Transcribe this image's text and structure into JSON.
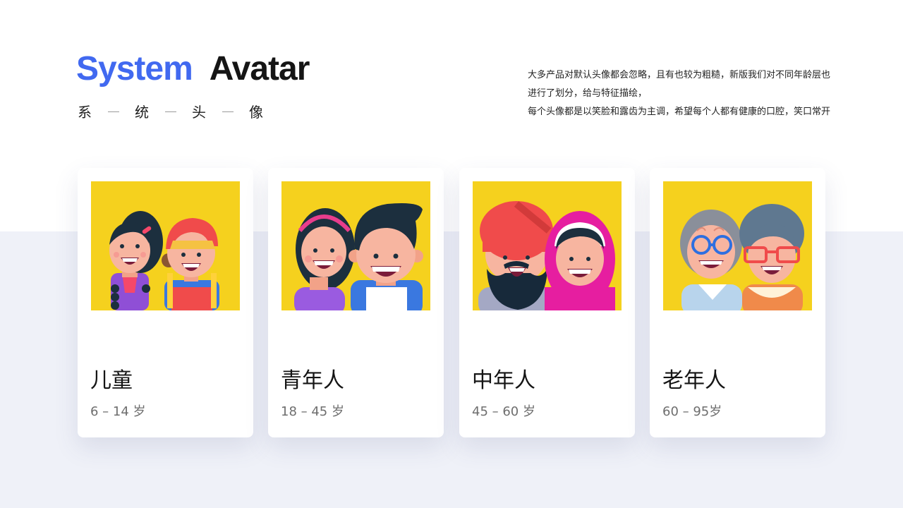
{
  "header": {
    "title_word1": "System",
    "title_word2": "Avatar",
    "subtitle_chars": [
      "系",
      "统",
      "头",
      "像"
    ]
  },
  "description": {
    "line1": "大多产品对默认头像都会忽略，且有也较为粗糙，新版我们对不同年龄层也进行了划分，给与特征描绘，",
    "line2": "每个头像都是以笑脸和露齿为主调，希望每个人都有健康的口腔，笑口常开"
  },
  "cards": [
    {
      "name": "儿童",
      "age": "6 – 14 岁",
      "art": "children-avatar-illustration"
    },
    {
      "name": "青年人",
      "age": "18 – 45 岁",
      "art": "youth-avatar-illustration"
    },
    {
      "name": "中年人",
      "age": "45 – 60 岁",
      "art": "middle-aged-avatar-illustration"
    },
    {
      "name": "老年人",
      "age": "60 – 95岁",
      "art": "elderly-avatar-illustration"
    }
  ],
  "colors": {
    "accent": "#4169f0",
    "art_background": "#f5d11e",
    "band_background": "#eff1f8"
  }
}
